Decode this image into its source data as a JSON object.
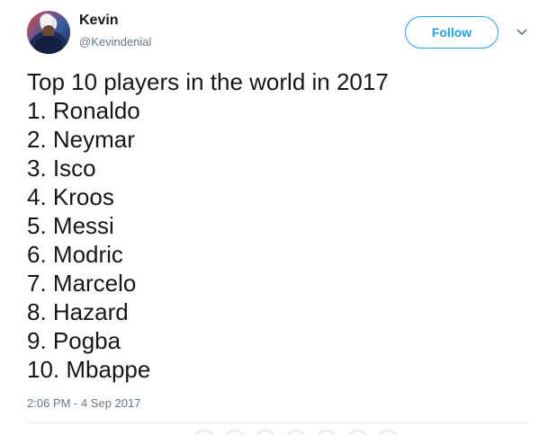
{
  "user": {
    "name": "Kevin",
    "handle": "@Kevindenial"
  },
  "header": {
    "follow_label": "Follow",
    "menu_icon": "chevron-down-icon",
    "accent_color": "#1da1f2"
  },
  "tweet": {
    "lines": [
      "Top 10 players in the world in 2017",
      "1. Ronaldo",
      "2. Neymar",
      "3. Isco",
      "4. Kroos",
      "5. Messi",
      "6. Modric",
      "7. Marcelo",
      "8. Hazard",
      "9. Pogba",
      "10. Mbappe"
    ],
    "timestamp": "2:06 PM - 4 Sep 2017"
  }
}
